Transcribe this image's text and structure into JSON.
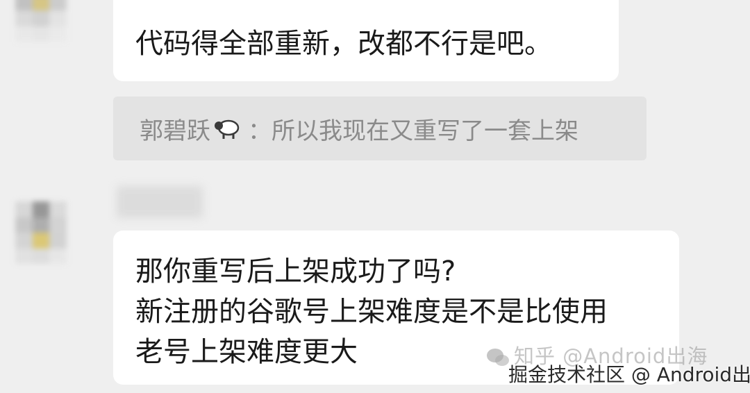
{
  "messages": [
    {
      "lines": [
        "代码得全部重新，改都不行是吧。"
      ]
    },
    {
      "lines": [
        "那你重写后上架成功了吗?",
        "新注册的谷歌号上架难度是不是比使用",
        "老号上架难度更大"
      ]
    }
  ],
  "quote": {
    "author": "郭碧跃",
    "separator": "：",
    "text": "所以我现在又重写了一套上架",
    "icon": "sheep-icon"
  },
  "watermarks": {
    "zhihu": "知乎 @Android出海",
    "juejin": "掘金技术社区 @ Android出海"
  },
  "colors": {
    "background": "#efefef",
    "bubble": "#ffffff",
    "quote_background": "#e3e3e3",
    "quote_text": "#8a8a8a"
  }
}
